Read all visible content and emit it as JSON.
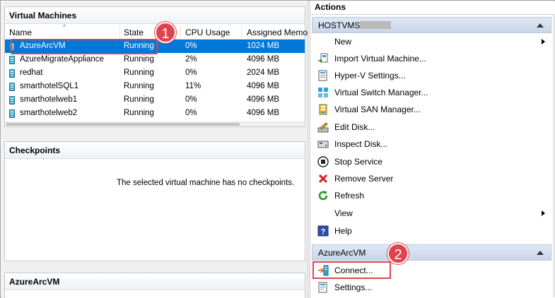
{
  "vm_panel": {
    "title": "Virtual Machines",
    "columns": [
      "Name",
      "State",
      "CPU Usage",
      "Assigned Memo"
    ],
    "rows": [
      {
        "name": "AzureArcVM",
        "state": "Running",
        "cpu": "0%",
        "memory": "1024 MB",
        "selected": true
      },
      {
        "name": "AzureMigrateAppliance",
        "state": "Running",
        "cpu": "2%",
        "memory": "4096 MB"
      },
      {
        "name": "redhat",
        "state": "Running",
        "cpu": "0%",
        "memory": "2024 MB"
      },
      {
        "name": "smarthotelSQL1",
        "state": "Running",
        "cpu": "11%",
        "memory": "4096 MB"
      },
      {
        "name": "smarthotelweb1",
        "state": "Running",
        "cpu": "0%",
        "memory": "4096 MB"
      },
      {
        "name": "smarthotelweb2",
        "state": "Running",
        "cpu": "0%",
        "memory": "4096 MB"
      }
    ]
  },
  "checkpoints_panel": {
    "title": "Checkpoints",
    "empty_message": "The selected virtual machine has no checkpoints."
  },
  "details_panel": {
    "title": "AzureArcVM"
  },
  "actions": {
    "title": "Actions",
    "host_group": {
      "label": "HOSTVMS",
      "items": [
        {
          "label": "New",
          "icon": "blank",
          "submenu": true
        },
        {
          "label": "Import Virtual Machine...",
          "icon": "import-vm-icon"
        },
        {
          "label": "Hyper-V Settings...",
          "icon": "hyperv-settings-icon"
        },
        {
          "label": "Virtual Switch Manager...",
          "icon": "virtual-switch-icon"
        },
        {
          "label": "Virtual SAN Manager...",
          "icon": "virtual-san-icon"
        },
        {
          "label": "Edit Disk...",
          "icon": "edit-disk-icon"
        },
        {
          "label": "Inspect Disk...",
          "icon": "inspect-disk-icon"
        },
        {
          "label": "Stop Service",
          "icon": "stop-service-icon"
        },
        {
          "label": "Remove Server",
          "icon": "remove-x-icon"
        },
        {
          "label": "Refresh",
          "icon": "refresh-icon"
        },
        {
          "label": "View",
          "icon": "blank",
          "submenu": true
        },
        {
          "label": "Help",
          "icon": "help-icon"
        }
      ]
    },
    "vm_group": {
      "label": "AzureArcVM",
      "items": [
        {
          "label": "Connect...",
          "icon": "connect-icon"
        },
        {
          "label": "Settings...",
          "icon": "settings-icon"
        }
      ]
    }
  },
  "callouts": [
    "1",
    "2"
  ],
  "colors": {
    "selection": "#0078d7",
    "callout": "#e0434f",
    "group_header": "#c8d6ea"
  }
}
